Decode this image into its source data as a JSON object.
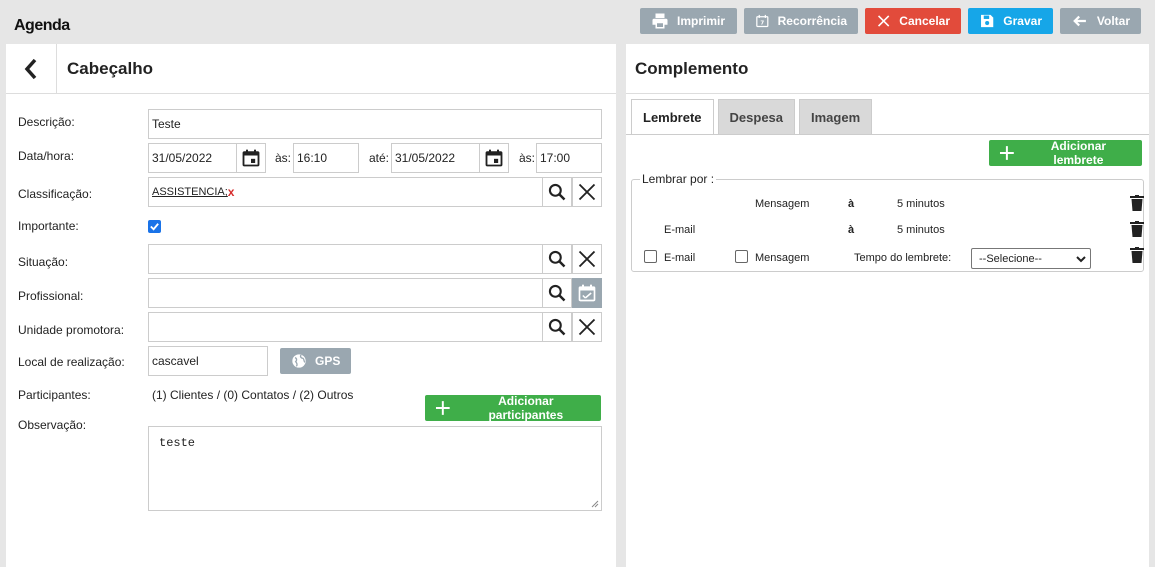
{
  "app": {
    "title": "Agenda"
  },
  "toolbar": {
    "print_label": "Imprimir",
    "recurrence_label": "Recorrência",
    "cancel_label": "Cancelar",
    "save_label": "Gravar",
    "back_label": "Voltar"
  },
  "left": {
    "title": "Cabeçalho",
    "fields": {
      "descricao_label": "Descrição:",
      "descricao_value": "Teste",
      "datahora_label": "Data/hora:",
      "date_start": "31/05/2022",
      "as_label_1": "às:",
      "time_start": "16:10",
      "ate_label": "até:",
      "date_end": "31/05/2022",
      "as_label_2": "às:",
      "time_end": "17:00",
      "classificacao_label": "Classificação:",
      "classificacao_value": "ASSISTENCIA;",
      "classificacao_remove": "x",
      "importante_label": "Importante:",
      "importante_checked": true,
      "situacao_label": "Situação:",
      "profissional_label": "Profissional:",
      "unidade_label": "Unidade promotora:",
      "local_label": "Local de realização:",
      "local_value": "cascavel",
      "gps_label": "GPS",
      "participantes_label": "Participantes:",
      "participantes_value": "(1) Clientes / (0) Contatos / (2) Outros",
      "add_participantes_label": "Adicionar participantes",
      "observacao_label": "Observação:",
      "observacao_value": "teste"
    }
  },
  "right": {
    "title": "Complemento",
    "tabs": [
      {
        "label": "Lembrete",
        "active": true
      },
      {
        "label": "Despesa",
        "active": false
      },
      {
        "label": "Imagem",
        "active": false
      }
    ],
    "add_lembrete_label": "Adicionar lembrete",
    "lembrar_legend": "Lembrar por :",
    "reminders": [
      {
        "via": "Mensagem",
        "a": "à",
        "time": "5 minutos"
      },
      {
        "via": "E-mail",
        "a": "à",
        "time": "5 minutos"
      }
    ],
    "new_row": {
      "email_label": "E-mail",
      "mensagem_label": "Mensagem",
      "tempo_label": "Tempo do lembrete:",
      "select_value": "--Selecione--"
    }
  },
  "colors": {
    "gray_button": "#9aa7b0",
    "cancel": "#e24b3b",
    "save": "#16a6e8",
    "green": "#3fae49",
    "checkbox_blue": "#1a73e8"
  }
}
